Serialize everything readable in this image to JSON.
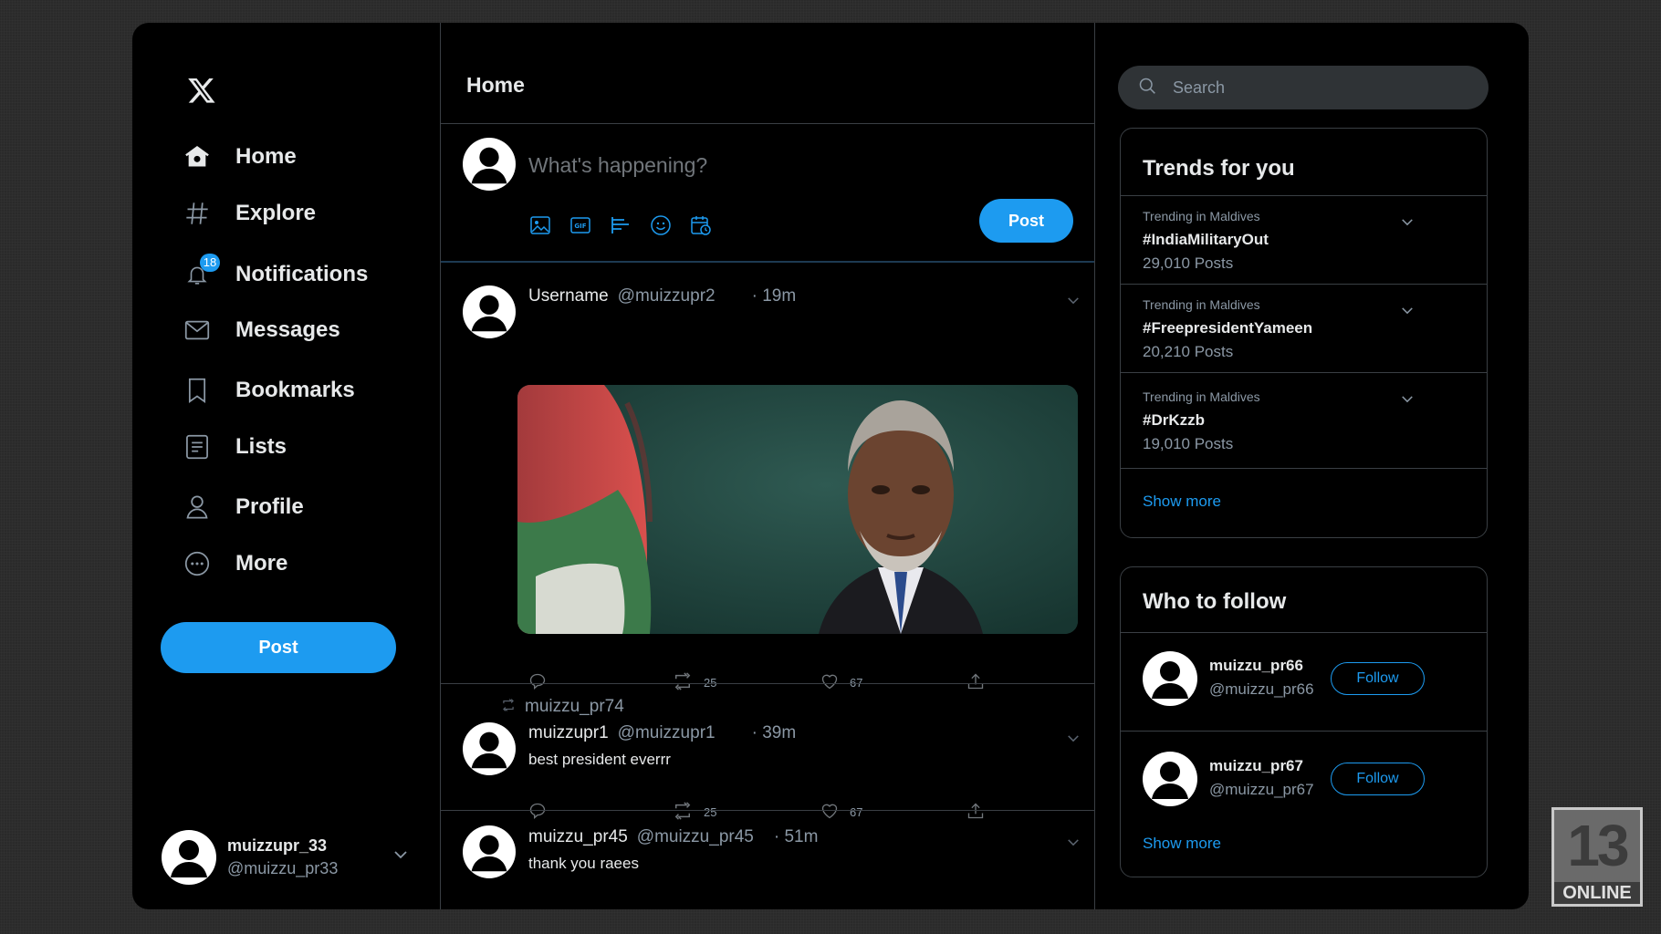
{
  "sidebar": {
    "logo": "x-logo",
    "nav": [
      {
        "label": "Home",
        "icon": "home-icon"
      },
      {
        "label": "Explore",
        "icon": "hashtag-icon"
      },
      {
        "label": "Notifications",
        "icon": "bell-icon",
        "badge": "18"
      },
      {
        "label": "Messages",
        "icon": "envelope-icon"
      },
      {
        "label": "Bookmarks",
        "icon": "bookmark-icon"
      },
      {
        "label": "Lists",
        "icon": "list-icon"
      },
      {
        "label": "Profile",
        "icon": "person-icon"
      },
      {
        "label": "More",
        "icon": "more-circle-icon"
      }
    ],
    "post_label": "Post",
    "account": {
      "name": "muizzupr_33",
      "handle": "@muizzu_pr33"
    }
  },
  "main": {
    "title": "Home",
    "composer": {
      "placeholder": "What's happening?",
      "post_label": "Post"
    },
    "tweets": [
      {
        "user": "Username",
        "handle": "@muizzupr2",
        "time": "· 19m",
        "retweets": "25",
        "likes": "67"
      },
      {
        "retweeted_by": "muizzu_pr74",
        "user": "muizzupr1",
        "handle": "@muizzupr1",
        "time": "· 39m",
        "text": "best president everrr",
        "retweets": "25",
        "likes": "67"
      },
      {
        "user": "muizzu_pr45",
        "handle": "@muizzu_pr45",
        "time": "· 51m",
        "text": "thank you raees"
      }
    ]
  },
  "right": {
    "search_placeholder": "Search",
    "trends": {
      "title": "Trends for you",
      "items": [
        {
          "context": "Trending in Maldives",
          "tag": "#IndiaMilitaryOut",
          "count": "29,010 Posts"
        },
        {
          "context": "Trending in Maldives",
          "tag": "#FreepresidentYameen",
          "count": "20,210 Posts"
        },
        {
          "context": "Trending in Maldives",
          "tag": "#DrKzzb",
          "count": "19,010 Posts"
        }
      ],
      "show_more": "Show more"
    },
    "who_to_follow": {
      "title": "Who to follow",
      "items": [
        {
          "name": "muizzu_pr66",
          "handle": "@muizzu_pr66",
          "button": "Follow"
        },
        {
          "name": "muizzu_pr67",
          "handle": "@muizzu_pr67",
          "button": "Follow"
        }
      ],
      "show_more": "Show more"
    }
  },
  "watermark": {
    "number": "13",
    "text": "ONLINE"
  },
  "colors": {
    "accent": "#1d9bf0",
    "background": "#000000",
    "border": "#3a3f44",
    "muted": "#8b98a5"
  }
}
